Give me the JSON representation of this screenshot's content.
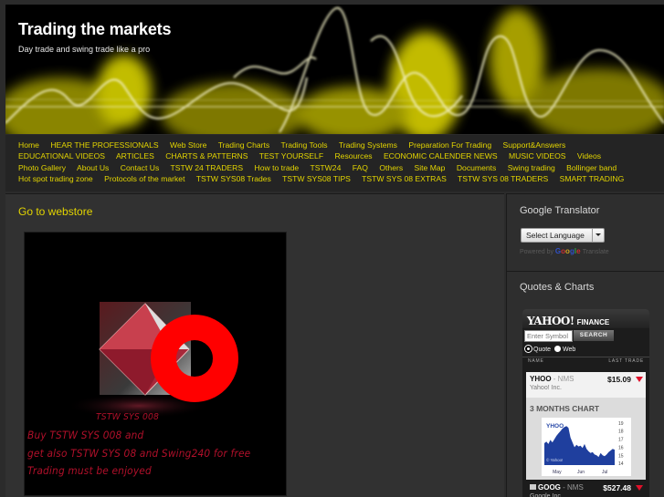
{
  "site": {
    "title": "Trading the markets",
    "tagline": "Day trade and swing trade like a pro"
  },
  "nav": {
    "items": [
      "Home",
      "HEAR THE PROFESSIONALS",
      "Web Store",
      "Trading Charts",
      "Trading Tools",
      "Trading Systems",
      "Preparation For Trading",
      "Support&Answers",
      "EDUCATIONAL VIDEOS",
      "ARTICLES",
      "CHARTS & PATTERNS",
      "TEST YOURSELF",
      "Resources",
      "ECONOMIC CALENDER NEWS",
      "MUSIC VIDEOS",
      "Videos",
      "Photo Gallery",
      "About Us",
      "Contact Us",
      "TSTW 24 TRADERS",
      "How to trade",
      "TSTW24",
      "FAQ",
      "Others",
      "Site Map",
      "Documents",
      "Swing trading",
      "Bollinger band",
      "Hot spot trading zone",
      "Protocols of the market",
      "TSTW SYS08 Trades",
      "TSTW SYS08 TIPS",
      "TSTW SYS 08 EXTRAS",
      "TSTW SYS 08 TRADERS",
      "SMART TRADING"
    ],
    "color": "#e3d400"
  },
  "main": {
    "title": "Go to webstore",
    "banner": {
      "caption": "TSTW SYS 008",
      "line1": "Buy TSTW SYS 008 and",
      "line2": "get also TSTW SYS 08 and Swing240 for free",
      "line3": "Trading must be enjoyed"
    }
  },
  "sidebar": {
    "translator": {
      "title": "Google Translator",
      "select_label": "Select Language",
      "powered_by": "Powered by",
      "google": "Google",
      "translate": "Translate"
    },
    "quotes": {
      "title": "Quotes & Charts",
      "brand": "YAHOO!",
      "brand_sub": "FINANCE",
      "search_placeholder": "Enter Symbol",
      "search_button": "SEARCH",
      "radio_quote": "Quote",
      "radio_web": "Web",
      "col_name": "NAME",
      "col_last": "LAST TRADE",
      "stocks": [
        {
          "symbol": "YHOO",
          "exchange": " - NMS",
          "name": "Yahoo! Inc.",
          "price": "$15.09",
          "direction": "down"
        },
        {
          "symbol": "GOOG",
          "exchange": " - NMS",
          "name": "Google Inc.",
          "price": "$527.48",
          "direction": "down"
        }
      ],
      "chart": {
        "title": "3 MONTHS CHART",
        "symbol": "YHOO",
        "watermark": "© Yahoo!",
        "y_ticks": [
          "19",
          "18",
          "17",
          "16",
          "15",
          "14"
        ],
        "x_ticks": [
          "May",
          "Jun",
          "Jul"
        ],
        "ylim": [
          13.8,
          19.2
        ],
        "values": [
          16.5,
          16.7,
          16.4,
          16.9,
          16.6,
          17.0,
          17.4,
          17.7,
          18.0,
          18.3,
          18.5,
          18.6,
          18.4,
          17.2,
          16.6,
          16.0,
          16.3,
          16.1,
          16.2,
          15.9,
          16.4,
          15.8,
          15.5,
          15.3,
          15.4,
          15.1,
          15.0,
          14.8,
          15.3,
          15.0,
          14.9,
          15.1,
          15.4,
          15.6,
          15.8,
          15.7
        ]
      },
      "colors": {
        "down": "#e0102a",
        "chart_fill": "#1f3f9e"
      }
    }
  }
}
